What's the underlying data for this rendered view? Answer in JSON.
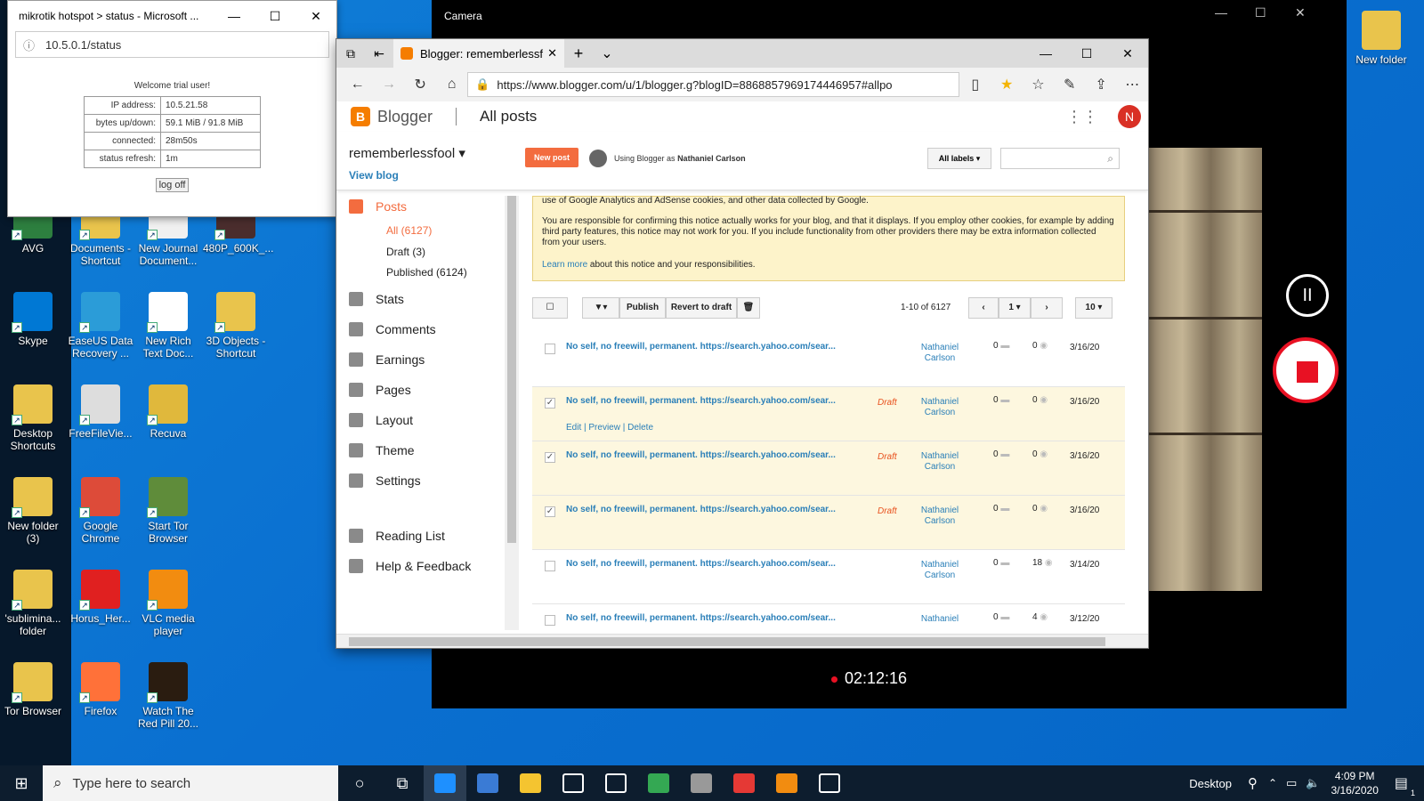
{
  "desktop": {
    "icons": [
      {
        "label": "AVG",
        "color": "#2d7f3f"
      },
      {
        "label": "Documents - Shortcut",
        "color": "#e9c44c"
      },
      {
        "label": "New Journal Document...",
        "color": "#f0f0f0"
      },
      {
        "label": "480P_600K_...",
        "color": "#4a2d2d"
      },
      {
        "label": "Skype",
        "color": "#0078d4"
      },
      {
        "label": "EaseUS Data Recovery ...",
        "color": "#2b9cd8"
      },
      {
        "label": "New Rich Text Doc...",
        "color": "#ffffff"
      },
      {
        "label": "3D Objects - Shortcut",
        "color": "#e9c44c"
      },
      {
        "label": "Desktop Shortcuts",
        "color": "#e9c44c"
      },
      {
        "label": "FreeFileVie...",
        "color": "#dddddd"
      },
      {
        "label": "Recuva",
        "color": "#e0b83c"
      },
      {
        "label": "New folder (3)",
        "color": "#e9c44c"
      },
      {
        "label": "Google Chrome",
        "color": "#dd4b39"
      },
      {
        "label": "Start Tor Browser",
        "color": "#5f8c3a"
      },
      {
        "label": "'sublimina... folder",
        "color": "#e9c44c"
      },
      {
        "label": "Horus_Her...",
        "color": "#e02020"
      },
      {
        "label": "VLC media player",
        "color": "#f28c10"
      },
      {
        "label": "Tor Browser",
        "color": "#e9c44c"
      },
      {
        "label": "Firefox",
        "color": "#ff7139"
      },
      {
        "label": "Watch The Red Pill 20...",
        "color": "#2a1c10"
      }
    ],
    "right_icon": "New folder"
  },
  "hotspot": {
    "title": "mikrotik hotspot > status - Microsoft ...",
    "url": "10.5.0.1/status",
    "welcome": "Welcome trial user!",
    "rows": [
      {
        "k": "IP address:",
        "v": "10.5.21.58"
      },
      {
        "k": "bytes up/down:",
        "v": "59.1 MiB / 91.8 MiB"
      },
      {
        "k": "connected:",
        "v": "28m50s"
      },
      {
        "k": "status refresh:",
        "v": "1m"
      }
    ],
    "logoff": "log off"
  },
  "camera": {
    "title": "Camera",
    "timer": "02:12:16"
  },
  "edge": {
    "tab_title": "Blogger: rememberlessf",
    "url": "https://www.blogger.com/u/1/blogger.g?blogID=8868857969174446957#allpo",
    "brand": "Blogger",
    "page_title": "All posts",
    "avatar": "N",
    "blog_name": "rememberlessfool",
    "view_blog": "View blog",
    "new_post": "New post",
    "using_as": "Using Blogger as",
    "user": "Nathaniel Carlson",
    "all_labels": "All labels",
    "sidebar": {
      "posts": "Posts",
      "all": "All (6127)",
      "draft": "Draft (3)",
      "published": "Published (6124)",
      "items": [
        "Stats",
        "Comments",
        "Earnings",
        "Pages",
        "Layout",
        "Theme",
        "Settings",
        "Reading List",
        "Help & Feedback"
      ]
    },
    "notice": {
      "line1": "use of Google Analytics and AdSense cookies, and other data collected by Google.",
      "line2": "You are responsible for confirming this notice actually works for your blog, and that it displays. If you employ other cookies, for example by adding third party features, this notice may not work for you. If you include functionality from other providers there may be extra information collected from your users.",
      "learn": "Learn more",
      "learn_rest": "about this notice and your responsibilities."
    },
    "toolbar": {
      "publish": "Publish",
      "revert": "Revert to draft",
      "range": "1-10 of 6127",
      "page": "1",
      "per_page": "10"
    },
    "rows": [
      {
        "title": "No self, no freewill, permanent. https://search.yahoo.com/sear...",
        "draft": "",
        "author": "Nathaniel Carlson",
        "comments": "0",
        "views": "0",
        "date": "3/16/20",
        "checked": false
      },
      {
        "title": "No self, no freewill, permanent. https://search.yahoo.com/sear...",
        "draft": "Draft",
        "author": "Nathaniel Carlson",
        "comments": "0",
        "views": "0",
        "date": "3/16/20",
        "checked": true,
        "actions": "Edit | Preview | Delete"
      },
      {
        "title": "No self, no freewill, permanent. https://search.yahoo.com/sear...",
        "draft": "Draft",
        "author": "Nathaniel Carlson",
        "comments": "0",
        "views": "0",
        "date": "3/16/20",
        "checked": true
      },
      {
        "title": "No self, no freewill, permanent. https://search.yahoo.com/sear...",
        "draft": "Draft",
        "author": "Nathaniel Carlson",
        "comments": "0",
        "views": "0",
        "date": "3/16/20",
        "checked": true
      },
      {
        "title": "No self, no freewill, permanent. https://search.yahoo.com/sear...",
        "draft": "",
        "author": "Nathaniel Carlson",
        "comments": "0",
        "views": "18",
        "date": "3/14/20",
        "checked": false
      },
      {
        "title": "No self, no freewill, permanent. https://search.yahoo.com/sear...",
        "draft": "",
        "author": "Nathaniel",
        "comments": "0",
        "views": "4",
        "date": "3/12/20",
        "checked": false
      }
    ]
  },
  "taskbar": {
    "search_placeholder": "Type here to search",
    "desktop_label": "Desktop",
    "time": "4:09 PM",
    "date": "3/16/2020",
    "notif": "1",
    "apps": [
      "#1e90ff",
      "#3a7bd5",
      "#f4c430",
      "#ffffff",
      "#ffffff",
      "#34a853",
      "#999999",
      "#e53935",
      "#f28c10",
      "#ffffff"
    ]
  }
}
